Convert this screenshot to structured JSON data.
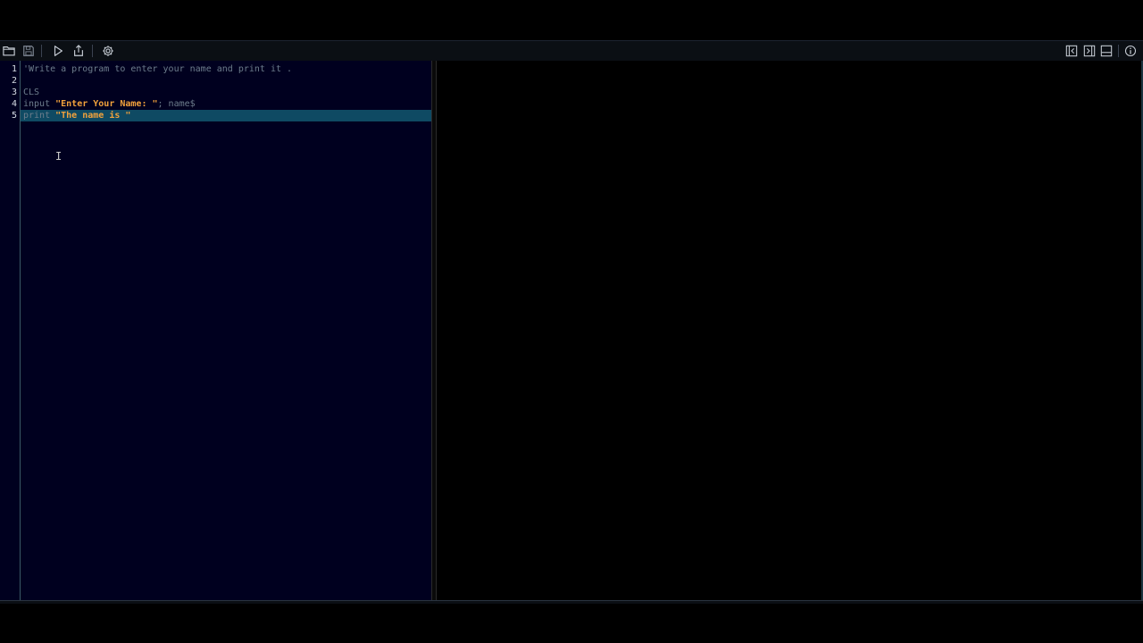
{
  "toolbar": {
    "left_icons": [
      "open-folder-icon",
      "save-icon",
      "run-icon",
      "share-icon",
      "settings-icon"
    ],
    "right_icons": [
      "collapse-left-icon",
      "collapse-right-icon",
      "panel-bottom-icon",
      "info-icon"
    ]
  },
  "editor": {
    "line_numbers": [
      "1",
      "2",
      "3",
      "4",
      "5"
    ],
    "lines": [
      {
        "parts": [
          {
            "type": "cmt",
            "text": "'Write a program to enter your name and print it ."
          }
        ]
      },
      {
        "parts": []
      },
      {
        "parts": [
          {
            "type": "kw",
            "text": "CLS"
          }
        ]
      },
      {
        "parts": [
          {
            "type": "kw",
            "text": "input "
          },
          {
            "type": "str",
            "text": "\"Enter Your Name: \""
          },
          {
            "type": "id",
            "text": "; name$"
          }
        ]
      },
      {
        "parts": [
          {
            "type": "kw",
            "text": "print "
          },
          {
            "type": "str",
            "text": "\"The name is \""
          }
        ],
        "current": true
      }
    ]
  },
  "colors": {
    "editor_bg": "#00001f",
    "current_line": "#0f4a63",
    "string": "#f2a23c",
    "keyword": "#6d7d8c"
  }
}
